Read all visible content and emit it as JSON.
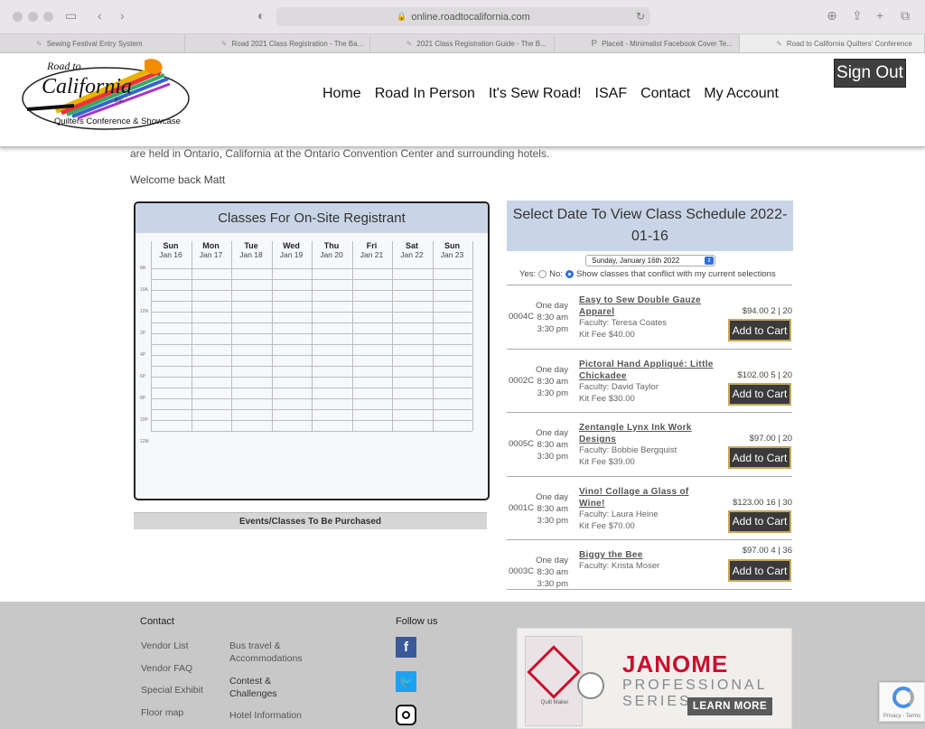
{
  "browser": {
    "url": "online.roadtocalifornia.com",
    "tabs": [
      {
        "label": "Sewing Festival Entry System"
      },
      {
        "label": "Road 2021 Class Registration - The Ba..."
      },
      {
        "label": "2021 Class Registration Guide - The B..."
      },
      {
        "label": "Placeit - Minimalist Facebook Cover Te..."
      },
      {
        "label": "Road to California Quilters' Conference"
      }
    ]
  },
  "header": {
    "logo_top": "Road to",
    "logo_main": "California",
    "logo_inc": "Inc.",
    "logo_sub": "Quilters Conference & Showcase",
    "nav": [
      "Home",
      "Road In Person",
      "It's Sew Road!",
      "ISAF",
      "Contact",
      "My Account"
    ],
    "signout": "Sign Out"
  },
  "main": {
    "intro": "are held in Ontario, California at the Ontario Convention Center and surrounding hotels.",
    "welcome": "Welcome back Matt"
  },
  "calendar": {
    "title": "Classes For On-Site Registrant",
    "days": [
      {
        "name": "Sun",
        "date": "Jan 16"
      },
      {
        "name": "Mon",
        "date": "Jan 17"
      },
      {
        "name": "Tue",
        "date": "Jan 18"
      },
      {
        "name": "Wed",
        "date": "Jan 19"
      },
      {
        "name": "Thu",
        "date": "Jan 20"
      },
      {
        "name": "Fri",
        "date": "Jan 21"
      },
      {
        "name": "Sat",
        "date": "Jan 22"
      },
      {
        "name": "Sun",
        "date": "Jan 23"
      }
    ],
    "hours": [
      "8A",
      "10A",
      "12N",
      "2P",
      "4P",
      "6P",
      "8P",
      "10P",
      "12M"
    ],
    "purchased_label": "Events/Classes To Be Purchased"
  },
  "schedule": {
    "title": "Select Date To View Class Schedule 2022-01-16",
    "selected_date": "Sunday, January 16th 2022",
    "conflict_yes": "Yes:",
    "conflict_no": "No:",
    "conflict_label": "Show classes that conflict with my current selections",
    "cart_label": "Add to Cart",
    "classes": [
      {
        "when": "One day",
        "code": "0004C",
        "start": "8:30 am",
        "end": "3:30 pm",
        "title": "Easy to Sew Double Gauze Apparel",
        "faculty": "Faculty: Teresa Coates",
        "kit": "Kit Fee $40.00",
        "price": "$94.00 2 | 20"
      },
      {
        "when": "One day",
        "code": "0002C",
        "start": "8:30 am",
        "end": "3:30 pm",
        "title": "Pictoral Hand Appliqué: Little Chickadee",
        "faculty": "Faculty: David Taylor",
        "kit": "Kit Fee $30.00",
        "price": "$102.00 5 | 20"
      },
      {
        "when": "One day",
        "code": "0005C",
        "start": "8:30 am",
        "end": "3:30 pm",
        "title": "Zentangle Lynx Ink Work Designs",
        "faculty": "Faculty: Bobbie Bergquist",
        "kit": "Kit Fee $39.00",
        "price": "$97.00 | 20"
      },
      {
        "when": "One day",
        "code": "0001C",
        "start": "8:30 am",
        "end": "3:30 pm",
        "title": "Vino! Collage a Glass of Wine!",
        "faculty": "Faculty: Laura Heine",
        "kit": "Kit Fee $70.00",
        "price": "$123.00 16 | 30"
      },
      {
        "when": "One day",
        "code": "0003C",
        "start": "8:30 am",
        "end": "3:30 pm",
        "title": "Biggy the Bee",
        "faculty": "Faculty: Krista Moser",
        "kit": "",
        "price": "$97.00 4 | 36"
      }
    ]
  },
  "footer": {
    "contact_heading": "Contact",
    "links_col1": [
      "Vendor List",
      "Vendor FAQ",
      "Special Exhibit",
      "Floor map"
    ],
    "links_col2": [
      "Bus travel & Accommodations",
      "Contest & Challenges",
      "Hotel Information"
    ],
    "follow_heading": "Follow us",
    "social": [
      "facebook-icon",
      "twitter-icon",
      "instagram-icon"
    ]
  },
  "ad": {
    "brand": "JANOME",
    "sub": "PROFESSIONAL SERIES",
    "cta": "LEARN MORE",
    "book": "Quilt Maker"
  },
  "recaptcha": {
    "label": "Privacy - Terms"
  }
}
